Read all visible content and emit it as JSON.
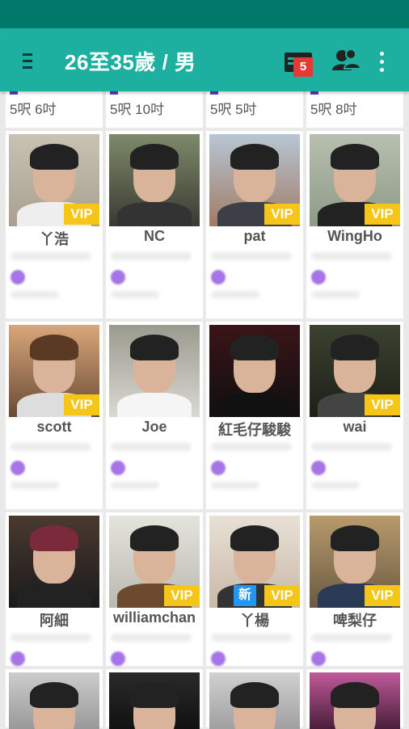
{
  "header": {
    "title": "26至35歲 / 男",
    "message_badge": "5",
    "menu_icon": "hamburger-menu-icon",
    "message_icon": "message-icon",
    "friends_icon": "friends-icon",
    "more_icon": "more-vert-icon"
  },
  "colors": {
    "appbar": "#1db0a0",
    "statusbar": "#00796b",
    "vip": "#f5c518",
    "new": "#2196f3",
    "badge": "#e53935"
  },
  "top_row_heights": [
    "5呎 6吋",
    "5呎 10吋",
    "5呎 5吋",
    "5呎 8吋"
  ],
  "users": [
    {
      "name": "丫浩",
      "vip": "VIP",
      "new": ""
    },
    {
      "name": "NC",
      "vip": "",
      "new": ""
    },
    {
      "name": "pat",
      "vip": "VIP",
      "new": ""
    },
    {
      "name": "WingHo",
      "vip": "VIP",
      "new": ""
    },
    {
      "name": "scott",
      "vip": "VIP",
      "new": ""
    },
    {
      "name": "Joe",
      "vip": "",
      "new": ""
    },
    {
      "name": "紅毛仔駿駿",
      "vip": "",
      "new": ""
    },
    {
      "name": "wai",
      "vip": "VIP",
      "new": ""
    },
    {
      "name": "阿細",
      "vip": "",
      "new": ""
    },
    {
      "name": "williamchan",
      "vip": "VIP",
      "new": ""
    },
    {
      "name": "丫楊",
      "vip": "VIP",
      "new": "新"
    },
    {
      "name": "啤梨仔",
      "vip": "VIP",
      "new": ""
    },
    {
      "name": "",
      "vip": "",
      "new": ""
    },
    {
      "name": "",
      "vip": "",
      "new": ""
    },
    {
      "name": "",
      "vip": "",
      "new": ""
    },
    {
      "name": "",
      "vip": "",
      "new": ""
    }
  ]
}
